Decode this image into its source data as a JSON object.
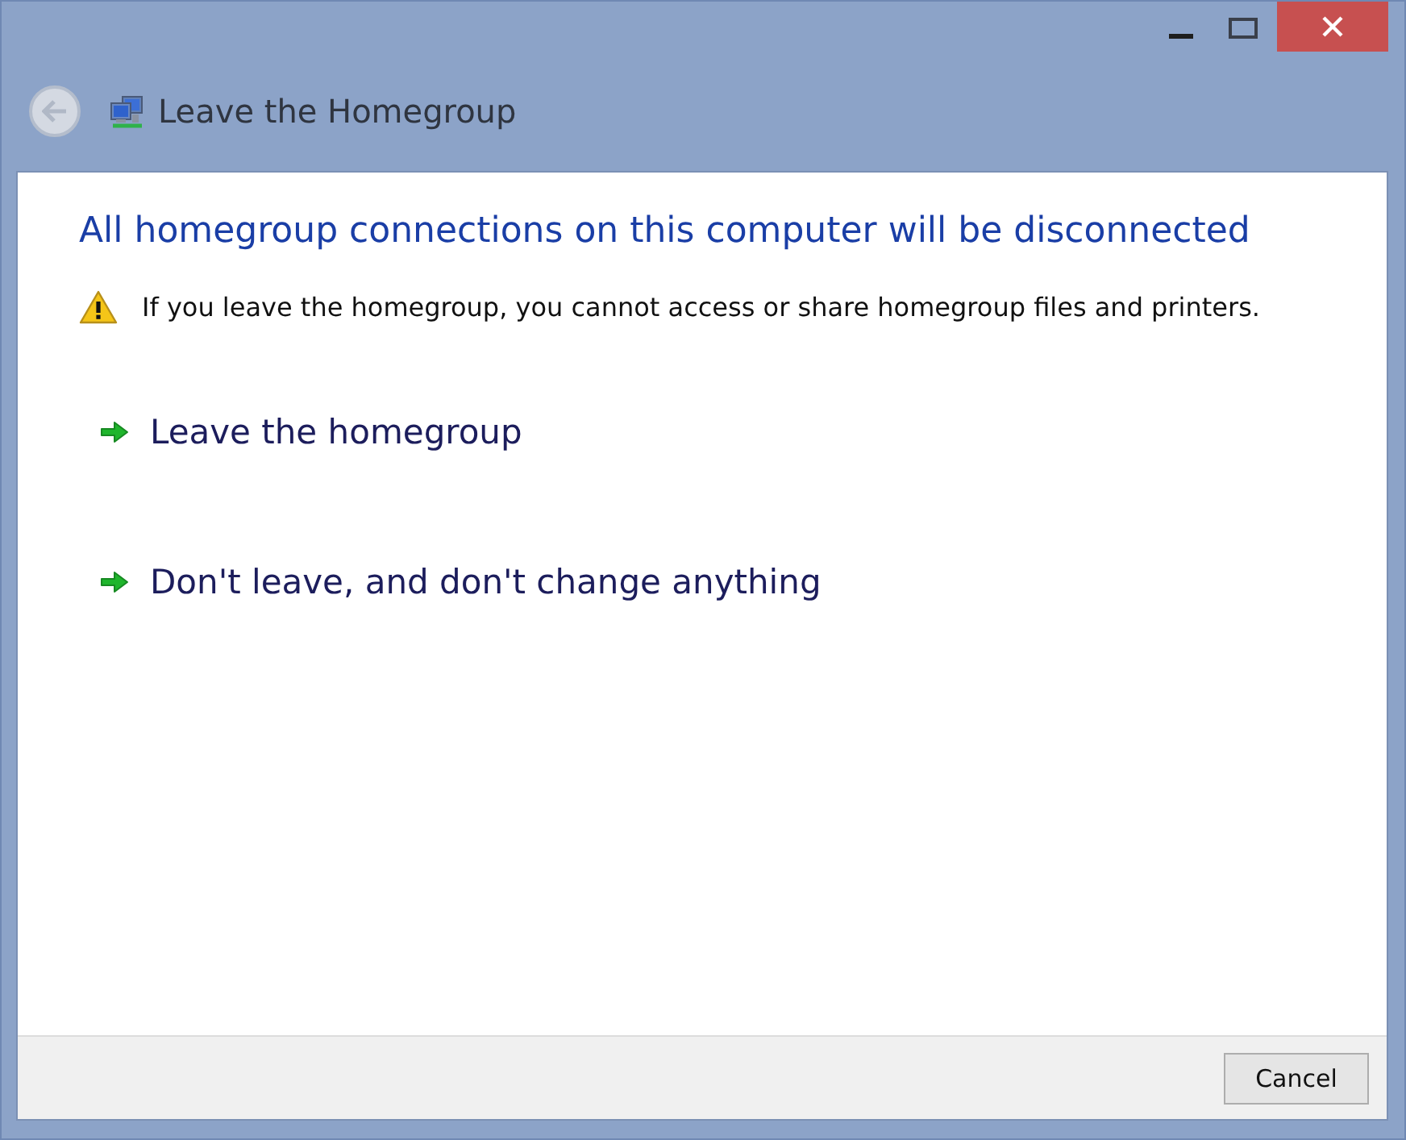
{
  "header": {
    "title": "Leave the Homegroup"
  },
  "heading": "All homegroup connections on this computer will be disconnected",
  "warning": "If you leave the homegroup, you cannot access or share homegroup files and printers.",
  "options": [
    {
      "label": "Leave the homegroup"
    },
    {
      "label": "Don't leave, and don't change anything"
    }
  ],
  "buttons": [
    "Cancel"
  ]
}
